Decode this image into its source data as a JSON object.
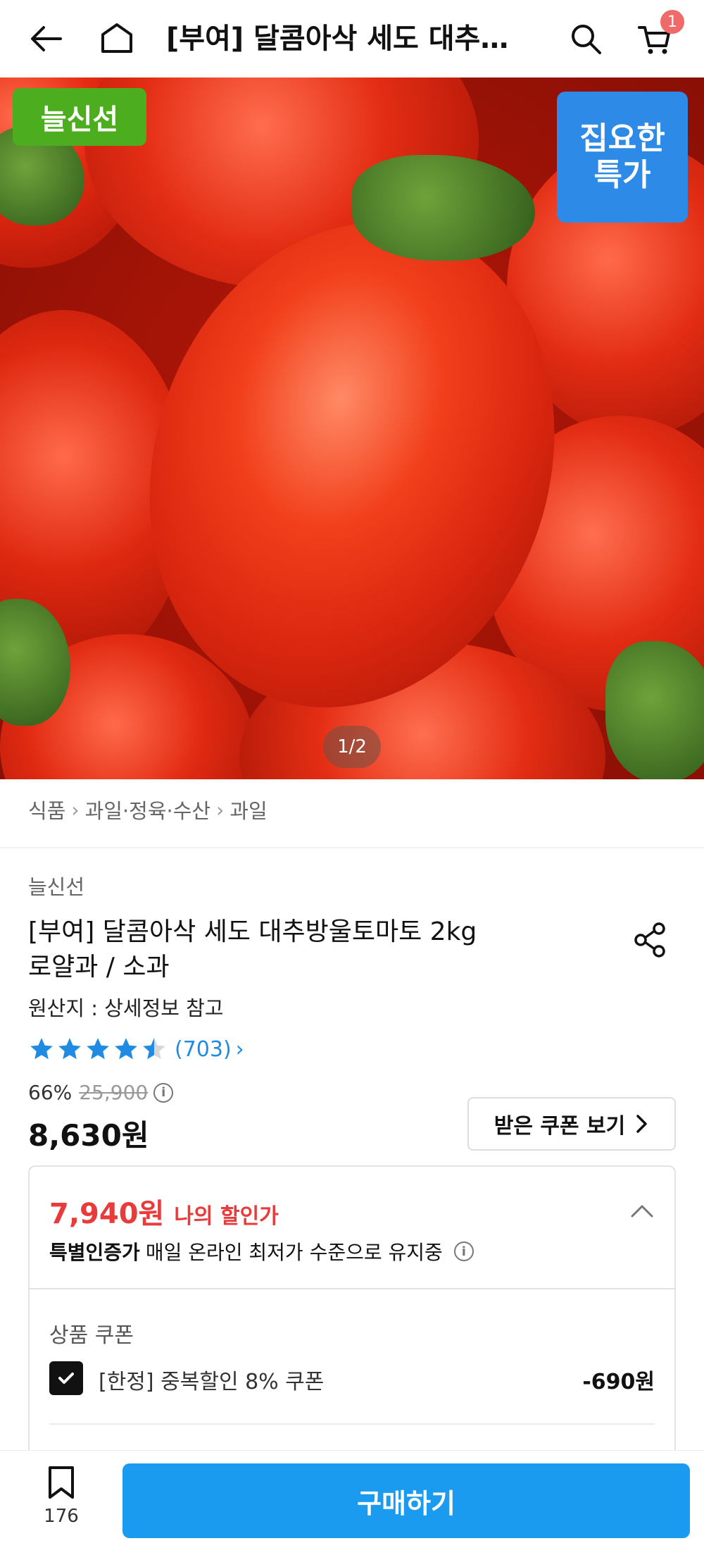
{
  "header": {
    "title": "[부여] 달콤아삭 세도 대추방울토마토 2kg 로얄과 / 소과",
    "cart_badge": "1"
  },
  "hero": {
    "fresh_tag": "늘신선",
    "special_tag_line1": "집요한",
    "special_tag_line2": "특가",
    "pager": "1/2"
  },
  "breadcrumb": {
    "items": [
      "식품",
      "과일·정육·수산",
      "과일"
    ]
  },
  "product": {
    "brand": "늘신선",
    "title_line1": "[부여] 달콤아삭 세도 대추방울토마토 2kg",
    "title_line2": "로얄과 / 소과",
    "origin": "원산지 : 상세정보 참고",
    "rating_value": 4.5,
    "review_count": "(703)",
    "discount_rate": "66%",
    "original_price": "25,900",
    "price": "8,630원",
    "coupon_button": "받은 쿠폰 보기"
  },
  "discount_box": {
    "my_price": "7,940원",
    "my_price_label": "나의 할인가",
    "cert_strong": "특별인증가",
    "cert_text": "매일 온라인 최저가 수준으로 유지중",
    "coupon_section": "상품 쿠폰",
    "coupon_name": "[한정] 중복할인 8% 쿠폰",
    "coupon_amount": "-690원"
  },
  "bottom": {
    "wish_count": "176",
    "buy_label": "구매하기"
  },
  "colors": {
    "accent_blue": "#1a9bf0",
    "price_red": "#e83b3b",
    "fresh_green": "#4cad1e",
    "special_blue": "#2d8ae6"
  }
}
